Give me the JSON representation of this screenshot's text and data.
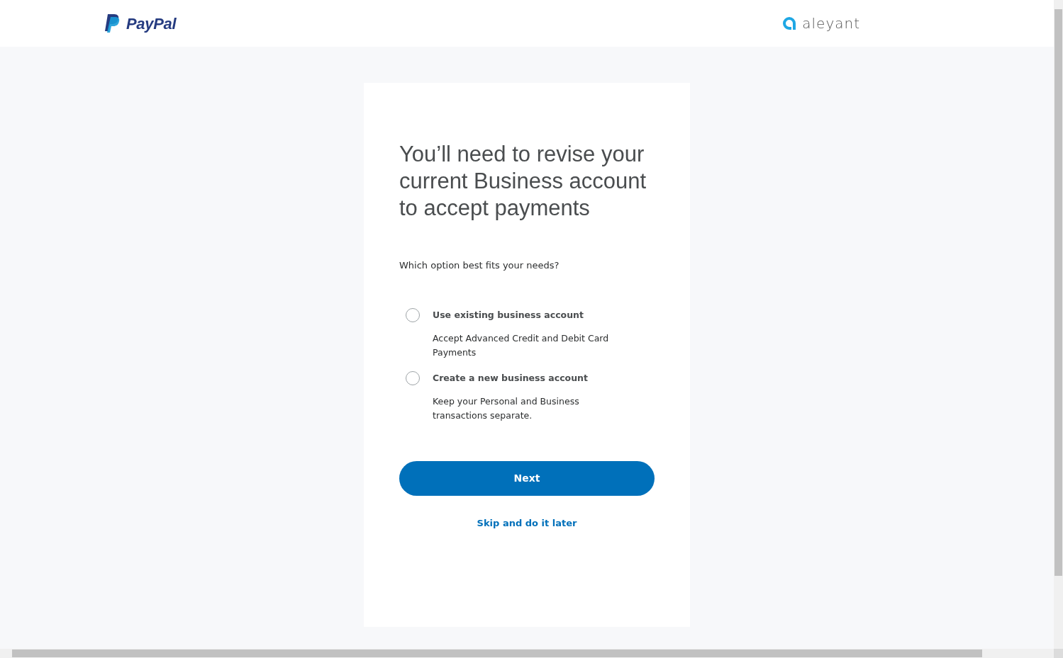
{
  "header": {
    "left_logo": "PayPal",
    "right_logo": "aleyant"
  },
  "card": {
    "title": "You’ll need to revise your current Business account to accept payments",
    "question": "Which option best fits your needs?",
    "options": [
      {
        "label": "Use existing business account",
        "description": "Accept Advanced Credit and Debit Card Payments",
        "selected": false
      },
      {
        "label": "Create a new business account",
        "description": "Keep your Personal and Business transactions separate.",
        "selected": false
      }
    ],
    "primary_button": "Next",
    "secondary_link": "Skip and do it later"
  }
}
